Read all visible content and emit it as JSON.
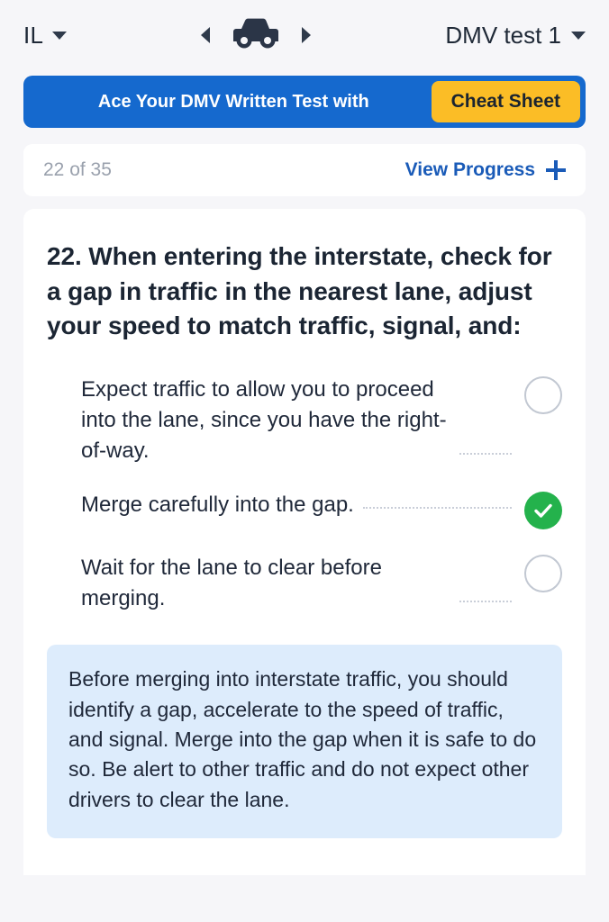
{
  "header": {
    "state_label": "IL",
    "state_caret_icon": "chevron-down-icon",
    "prev_icon": "triangle-left-icon",
    "car_icon": "car-icon",
    "next_icon": "triangle-right-icon",
    "test_label": "DMV test 1",
    "test_caret_icon": "chevron-down-icon"
  },
  "banner": {
    "text": "Ace Your DMV Written Test with",
    "cta_label": "Cheat Sheet",
    "background_color": "#1569ce",
    "cta_color": "#fbbd26"
  },
  "progress": {
    "count_label": "22 of 35",
    "view_progress_label": "View Progress",
    "plus_icon": "plus-icon",
    "link_color": "#1a5bb8"
  },
  "question": {
    "number": "22.",
    "text": "22. When entering the interstate, check for a gap in traffic in the nearest lane, adjust your speed to match traffic, signal, and:",
    "answers": [
      {
        "text": "Expect traffic to allow you to proceed into the lane, since you have the right-of-way.",
        "state": "empty",
        "marker_icon": "radio-empty-icon"
      },
      {
        "text": "Merge carefully into the gap.",
        "state": "correct",
        "marker_icon": "check-circle-icon"
      },
      {
        "text": "Wait for the lane to clear before merging.",
        "state": "empty",
        "marker_icon": "radio-empty-icon"
      }
    ],
    "explanation": "Before merging into interstate traffic, you should identify a gap, accelerate to the speed of traffic, and signal. Merge into the gap when it is safe to do so. Be alert to other traffic and do not expect other drivers to clear the lane.",
    "correct_color": "#24b24c",
    "explanation_bg": "#ddecfc"
  }
}
